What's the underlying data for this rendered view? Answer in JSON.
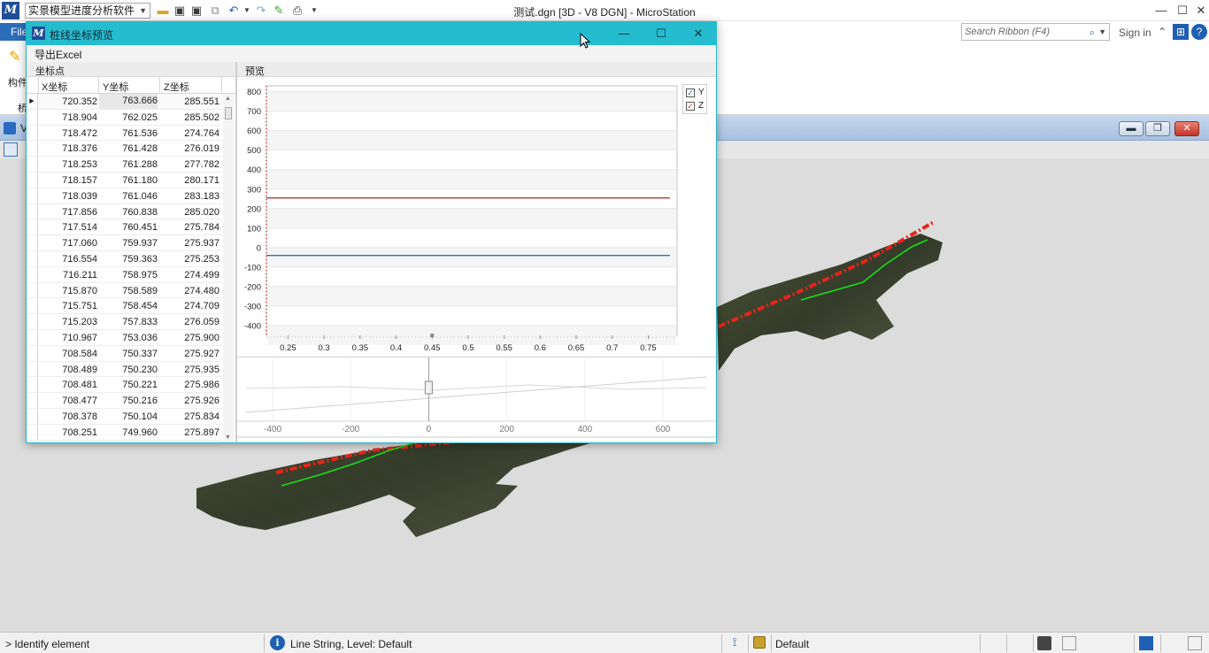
{
  "app": {
    "logo_letter": "M",
    "workflow": "实景模型进度分析软件",
    "title": "测试.dgn [3D - V8 DGN] - MicroStation",
    "controls": {
      "minimize": "—",
      "maximize": "☐",
      "close": "✕"
    }
  },
  "ribbon": {
    "file_tab": "File",
    "search_placeholder": "Search Ribbon (F4)",
    "sign_in": "Sign in",
    "build_label": "构件",
    "bridge_label": "桥"
  },
  "view": {
    "label": "V",
    "buttons": {
      "minimize": "▬",
      "restore": "❐",
      "close": "✕"
    }
  },
  "status": {
    "prompt": "> Identify element",
    "message": "Line String, Level: Default",
    "level": "Default"
  },
  "dialog": {
    "title": "桩线坐标预览",
    "logo_letter": "M",
    "menu_export": "导出Excel",
    "controls": {
      "minimize": "—",
      "maximize": "☐",
      "close": "✕"
    },
    "points_title": "坐标点",
    "preview_title": "预览",
    "grid": {
      "columns": [
        "X坐标",
        "Y坐标",
        "Z坐标"
      ],
      "rows": [
        [
          "720.352",
          "763.666",
          "285.551"
        ],
        [
          "718.904",
          "762.025",
          "285.502"
        ],
        [
          "718.472",
          "761.536",
          "274.764"
        ],
        [
          "718.376",
          "761.428",
          "276.019"
        ],
        [
          "718.253",
          "761.288",
          "277.782"
        ],
        [
          "718.157",
          "761.180",
          "280.171"
        ],
        [
          "718.039",
          "761.046",
          "283.183"
        ],
        [
          "717.856",
          "760.838",
          "285.020"
        ],
        [
          "717.514",
          "760.451",
          "275.784"
        ],
        [
          "717.060",
          "759.937",
          "275.937"
        ],
        [
          "716.554",
          "759.363",
          "275.253"
        ],
        [
          "716.211",
          "758.975",
          "274.499"
        ],
        [
          "715.870",
          "758.589",
          "274.480"
        ],
        [
          "715.751",
          "758.454",
          "274.709"
        ],
        [
          "715.203",
          "757.833",
          "276.059"
        ],
        [
          "710.967",
          "753.036",
          "275.900"
        ],
        [
          "708.584",
          "750.337",
          "275.927"
        ],
        [
          "708.489",
          "750.230",
          "275.935"
        ],
        [
          "708.481",
          "750.221",
          "275.986"
        ],
        [
          "708.477",
          "750.216",
          "275.926"
        ],
        [
          "708.378",
          "750.104",
          "275.834"
        ],
        [
          "708.251",
          "749.960",
          "275.897"
        ]
      ]
    },
    "legend": [
      {
        "name": "Y",
        "color": "#3c6fb3",
        "checked": true
      },
      {
        "name": "Z",
        "color": "#c0392b",
        "checked": true
      }
    ],
    "navigator_ticks": [
      "-400",
      "-200",
      "0",
      "200",
      "400",
      "600"
    ]
  },
  "chart_data": {
    "type": "line",
    "x": [
      0.22,
      0.78
    ],
    "xticks": [
      "0.25",
      "0.3",
      "0.35",
      "0.4",
      "0.45",
      "0.5",
      "0.55",
      "0.6",
      "0.65",
      "0.7",
      "0.75"
    ],
    "yticks": [
      "800",
      "700",
      "600",
      "500",
      "400",
      "300",
      "200",
      "100",
      "0",
      "-100",
      "-200",
      "-300",
      "-400"
    ],
    "xlim": [
      0.22,
      0.79
    ],
    "ylim": [
      -450,
      830
    ],
    "series": [
      {
        "name": "Y",
        "color": "#3c6fb3",
        "values": [
          -40,
          -40
        ]
      },
      {
        "name": "Z",
        "color": "#c0392b",
        "values": [
          255,
          255
        ]
      }
    ],
    "grid": true,
    "legend_position": "top-right"
  },
  "colors": {
    "dialog_title_bar": "#26bccf",
    "accent": "#2b6cb8",
    "terrain": "#3d4a30",
    "alignment_red": "#e8241a",
    "alignment_green": "#18e018"
  }
}
